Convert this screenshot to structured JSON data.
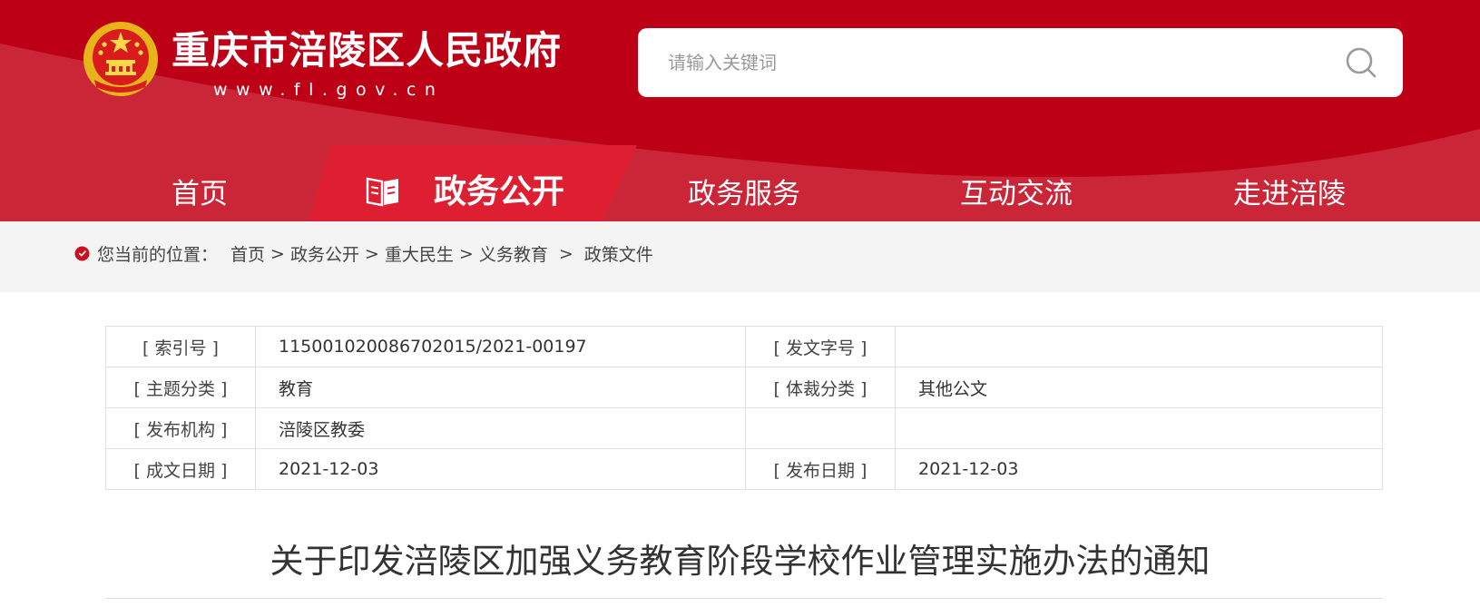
{
  "header": {
    "site_title": "重庆市涪陵区人民政府",
    "site_url": "www.fl.gov.cn",
    "search_placeholder": "请输入关键词",
    "colors": {
      "primary": "#bd0016",
      "light": "#d62a3c",
      "breadcrumb_bg": "#f4f4f4"
    }
  },
  "nav": {
    "items": [
      {
        "label": "首页",
        "active": false
      },
      {
        "label": "政务公开",
        "active": true
      },
      {
        "label": "政务服务",
        "active": false
      },
      {
        "label": "互动交流",
        "active": false
      },
      {
        "label": "走进涪陵",
        "active": false
      }
    ],
    "active_icon": "book-icon"
  },
  "breadcrumb": {
    "prefix": "您当前的位置：",
    "items": [
      "首页",
      "政务公开",
      "重大民生",
      "义务教育",
      "政策文件"
    ],
    "separator": ">",
    "icon": "location-pin-icon"
  },
  "meta": {
    "rows": [
      [
        "[ 索引号 ]",
        "115001020086702015/2021-00197",
        "[ 发文字号 ]",
        ""
      ],
      [
        "[ 主题分类 ]",
        "教育",
        "[ 体裁分类 ]",
        "其他公文"
      ],
      [
        "[ 发布机构 ]",
        "涪陵区教委",
        "",
        ""
      ],
      [
        "[ 成文日期 ]",
        "2021-12-03",
        "[ 发布日期 ]",
        "2021-12-03"
      ]
    ]
  },
  "document": {
    "title": "关于印发涪陵区加强义务教育阶段学校作业管理实施办法的通知"
  }
}
